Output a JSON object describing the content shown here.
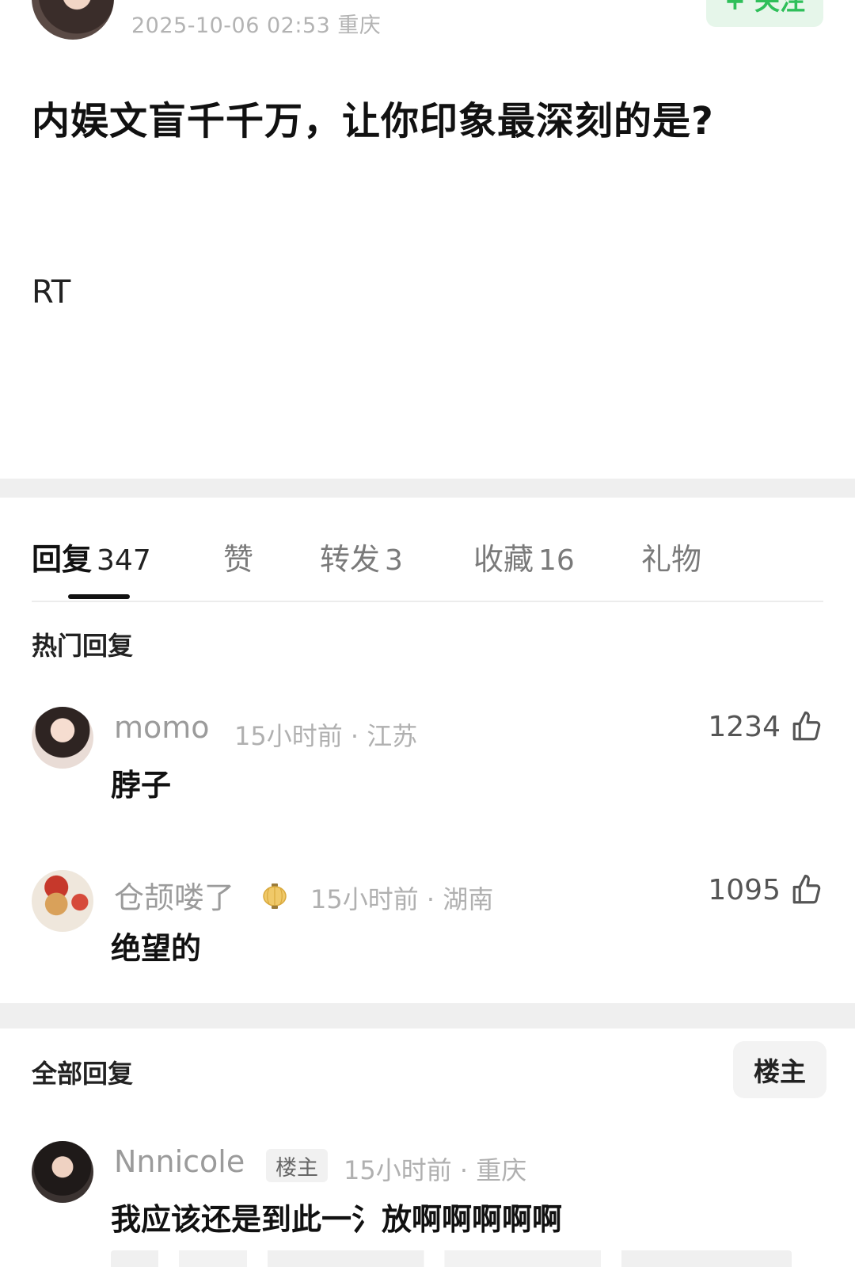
{
  "post": {
    "meta": "2025-10-06 02:53  重庆",
    "follow_label": "+ 关注",
    "title": "内娱文盲千千万，让你印象最深刻的是?",
    "body": "RT"
  },
  "tabs": [
    {
      "label": "回复",
      "count": "347",
      "active": true
    },
    {
      "label": "赞",
      "count": ""
    },
    {
      "label": "转发",
      "count": "3"
    },
    {
      "label": "收藏",
      "count": "16"
    },
    {
      "label": "礼物",
      "count": ""
    }
  ],
  "hot_replies": {
    "title": "热门回复",
    "items": [
      {
        "name": "momo",
        "meta": "15小时前 · 江苏",
        "content": "脖子",
        "likes": "1234"
      },
      {
        "name": "仓颉喽了",
        "meta": "15小时前 · 湖南",
        "content": "绝望的",
        "likes": "1095"
      }
    ]
  },
  "all_replies": {
    "title": "全部回复",
    "filter_label": "楼主",
    "items": [
      {
        "name": "Nnnicole",
        "tag": "楼主",
        "meta": "15小时前 · 重庆",
        "content": "我应该还是到此一氵放啊啊啊啊啊"
      }
    ]
  },
  "colors": {
    "accent_green": "#2fbf5a",
    "separator": "#efefef"
  }
}
